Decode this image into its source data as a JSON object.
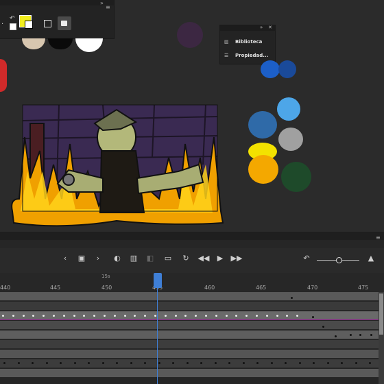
{
  "side_panel": {
    "library_label": "Biblioteca",
    "properties_label": "Propiedad...",
    "library_icon": "library-books-icon",
    "properties_icon": "sliders-icon"
  },
  "colors": {
    "fill": "#f2ee1e",
    "stroke": "#ffffff",
    "accent_playhead": "#3f7fd6",
    "onion_line": "#c050c0"
  },
  "timeline": {
    "ruler_labels": [
      "440",
      "445",
      "450",
      "455",
      "460",
      "465",
      "470",
      "475"
    ],
    "ruler_marker": "15s"
  },
  "icons": {
    "swap": "swap-colors-icon",
    "default": "default-colors-icon",
    "rect": "rectangle-icon",
    "lock": "lock-icon",
    "collapse": "collapse-icon",
    "close": "close-icon",
    "menu": "menu-icon"
  }
}
